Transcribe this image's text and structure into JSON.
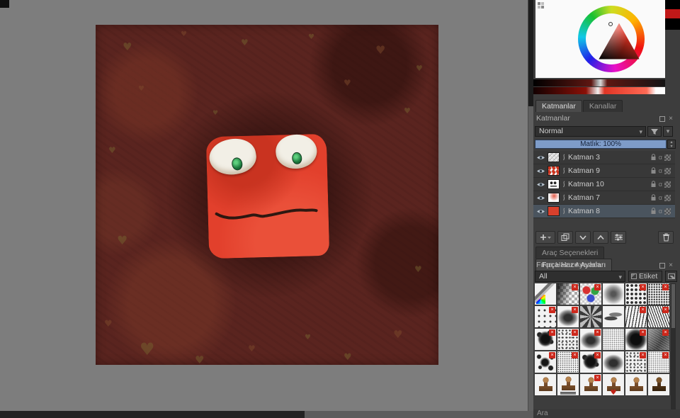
{
  "icons": {
    "caret_down": "▾",
    "caret_up": "▴",
    "alpha": "α",
    "close": "×",
    "plus": "+"
  },
  "artwork": {
    "description": "Dark maroon textured painting with scattered heart motifs and a red square creature with white eyes, green pupils and a black smile",
    "heart_glyph": "♥"
  },
  "layers_docker": {
    "tab_layers": "Katmanlar",
    "tab_channels": "Kanallar",
    "title": "Katmanlar",
    "blend_mode": "Normal",
    "opacity_label": "Matlık: 100%",
    "layers": [
      {
        "name": "Katman 3"
      },
      {
        "name": "Katman 9"
      },
      {
        "name": "Katman 10"
      },
      {
        "name": "Katman 7"
      },
      {
        "name": "Katman 8",
        "selected": true
      }
    ]
  },
  "brush_docker": {
    "tab_tool_options": "Araç Seçenekleri",
    "tab_brush_presets": "Fırça Hazır Ayarları",
    "title": "Fırça Hazır Ayarları",
    "filter_value": "All",
    "tag_label": "Etiket",
    "search_label": "Ara",
    "badge_glyph": "×",
    "presets": [
      {
        "pattern": "airbrush-pen",
        "badge": false
      },
      {
        "pattern": "checker-fade",
        "badge": true
      },
      {
        "pattern": "rgb-dots",
        "badge": true
      },
      {
        "pattern": "soft-round",
        "badge": false
      },
      {
        "pattern": "halftone",
        "badge": true
      },
      {
        "pattern": "halftone-fine",
        "badge": true
      },
      {
        "pattern": "dot-grid",
        "badge": true
      },
      {
        "pattern": "soft-blob",
        "badge": true
      },
      {
        "pattern": "swirl",
        "badge": false
      },
      {
        "pattern": "feather",
        "badge": false
      },
      {
        "pattern": "wavy-lines",
        "badge": true
      },
      {
        "pattern": "hatch",
        "badge": true
      },
      {
        "pattern": "splat",
        "badge": true
      },
      {
        "pattern": "spray",
        "badge": true
      },
      {
        "pattern": "soft-blob",
        "badge": true
      },
      {
        "pattern": "grain",
        "badge": false
      },
      {
        "pattern": "blob-dark",
        "badge": true
      },
      {
        "pattern": "chalk",
        "badge": true
      },
      {
        "pattern": "splatter",
        "badge": true
      },
      {
        "pattern": "spray-fine",
        "badge": true
      },
      {
        "pattern": "splat",
        "badge": true
      },
      {
        "pattern": "soft-blob",
        "badge": false
      },
      {
        "pattern": "spray",
        "badge": true
      },
      {
        "pattern": "grain",
        "badge": true
      },
      {
        "pattern": "stamp",
        "badge": false
      },
      {
        "pattern": "stamp-pine",
        "badge": false
      },
      {
        "pattern": "stamp",
        "badge": true
      },
      {
        "pattern": "stamp-heart",
        "badge": false
      },
      {
        "pattern": "stamp",
        "badge": false
      },
      {
        "pattern": "stamp-dark",
        "badge": false
      }
    ]
  },
  "color_docker": {
    "current_swatch_color": "#c01818"
  },
  "colors": {
    "panel_bg": "#3d3d3d",
    "opacity_bar_blue": "#7e9cc9",
    "selection_row": "#4a545e",
    "canvas_maroon": "#5a241f",
    "creature_red": "#e2402c",
    "badge_red": "#cc281c"
  }
}
